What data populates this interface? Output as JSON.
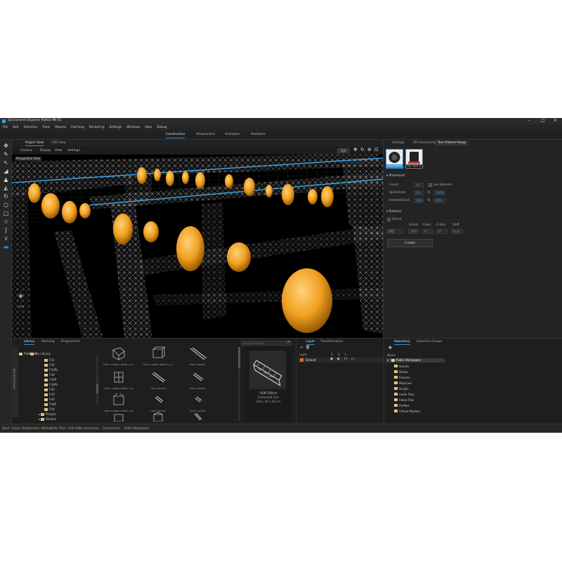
{
  "window": {
    "title": "Syncronorm Depence Pathos Mk R2"
  },
  "menu": [
    "File",
    "Edit",
    "Selection",
    "Tools",
    "Objects",
    "Patching",
    "Rendering",
    "Settings",
    "Windows",
    "Help",
    "Debug"
  ],
  "modes": [
    "Construction",
    "ShowControl",
    "Animation",
    "Hardware"
  ],
  "active_mode": "Construction",
  "viewport": {
    "tabs": [
      "Project View",
      "CAD View"
    ],
    "menu": [
      "Camera",
      "Display",
      "View",
      "Settings"
    ],
    "cad_button": "Cad",
    "perspective_label": "Perspective View"
  },
  "right_panel": {
    "tabs": [
      "Settings",
      "3D Interactivity",
      "Tool (Fixture Hang)"
    ],
    "thumbs": [
      {
        "label": "Spot Fixture",
        "selected": true
      },
      {
        "label": "Mac Viper XI",
        "selected": false
      }
    ],
    "placement": {
      "header": "Placement",
      "count_label": "Count",
      "count_value": "5x",
      "per_element_label": "per Element",
      "spline_from_label": "SplineFrom",
      "spline_from_value": "0%",
      "spline_to_label": "To",
      "spline_to_value": "100%",
      "element_limit_label": "ElementLimit",
      "element_limit_value": "10%",
      "element_limit_to_label": "To",
      "element_limit_to_value": "90%"
    },
    "rotation": {
      "header": "Rotation",
      "active_label": "Active",
      "axis_headers": [
        "X-Axis",
        "Y-Axis",
        "Z-Axis",
        "Shift"
      ],
      "mode_value": "XYZ",
      "axis_values": [
        "180°",
        "0°",
        "0°",
        "0cm"
      ]
    },
    "create_button": "Create"
  },
  "library": {
    "tabs": [
      "Library",
      "Patching",
      "Programmer"
    ],
    "search_placeholder": "Search in Library",
    "tree": [
      "Platform",
      "My Library",
      "F31",
      "F32",
      "F32PL",
      "F34",
      "F34P",
      "F34PL",
      "F42",
      "F43",
      "F44",
      "F44P",
      "F54",
      "Prolyte",
      "Stratus"
    ],
    "items": [
      "F44P 1-Way Corner C13 110°",
      "F44P 2-Way Corner C22 110°",
      "F44P 500cm",
      "F44P 3-Way Corner C30",
      "F44P 300cm",
      "F44P 200cm",
      "F44P 4-Way Corner C42",
      "F44P 150cm",
      "F44P 100cm",
      "",
      "",
      ""
    ],
    "preview": {
      "title": "F44P 200cm",
      "subtitle": "Estimated Size",
      "size": "200 x 40 x 40 cm"
    }
  },
  "layers": {
    "tabs": [
      "Layer",
      "Transformation"
    ],
    "header": "Layer",
    "columns": [
      "V",
      "S",
      "L"
    ],
    "rows": [
      {
        "name": "Default"
      }
    ]
  },
  "repository": {
    "tabs": [
      "Repository",
      "Selection Groups"
    ],
    "header": "Name",
    "root": "Public Workspace",
    "items": [
      "Scenes",
      "Shows",
      "Fixtures",
      "MapCues",
      "Scripts",
      "Audio Files",
      "Video Files",
      "Profiles",
      "Virtual Masters"
    ]
  },
  "status": [
    "Sport",
    "Visual: 4k0px",
    "Control: 48k0px",
    "Delta Time: 0.00 ms",
    "No connection",
    "Current User",
    "Public Workspace"
  ],
  "colors": {
    "accent": "#2e8fd8",
    "fixture": "#f0a020",
    "truss": "#9a9a9a",
    "spline": "#3aa0e0"
  }
}
